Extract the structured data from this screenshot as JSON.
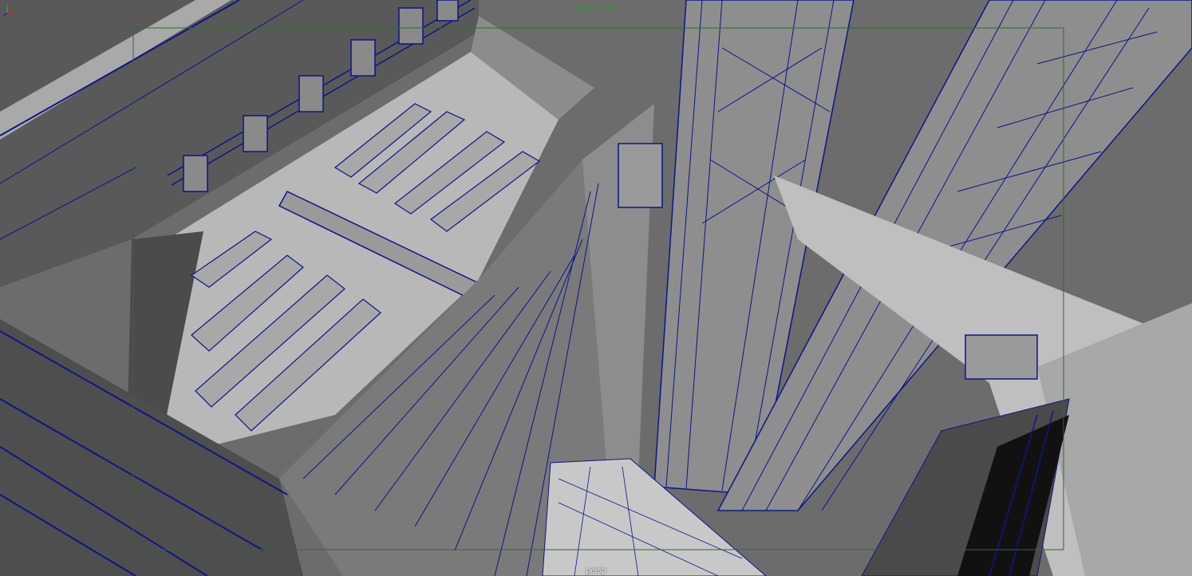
{
  "viewport": {
    "resolution_gate_label": "1920 x 1080",
    "camera_label": "persp",
    "colors": {
      "background": "#6b6b6b",
      "wireframe": "#0b1688",
      "gate": "#2f6b2f",
      "light_surface": "#b9b9b9",
      "mid_surface": "#8c8c8c",
      "dark_surface": "#4a4a4a"
    },
    "icons": [
      "axis-gizmo-icon"
    ]
  }
}
